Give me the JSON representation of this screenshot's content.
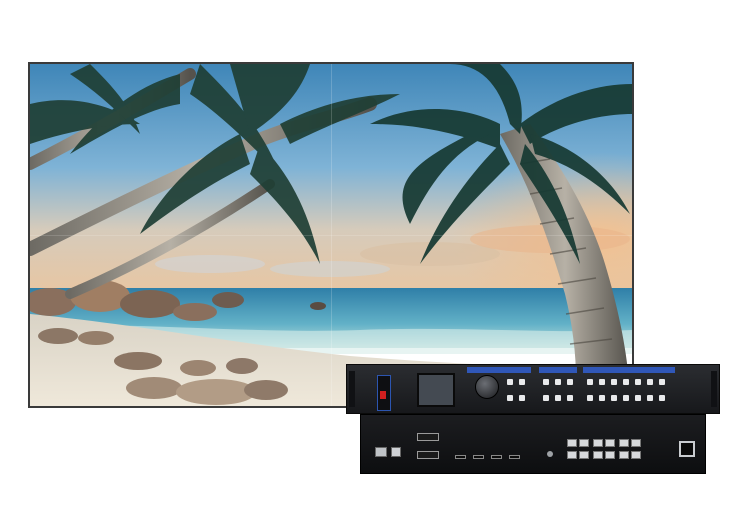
{
  "scene": {
    "subject": "led-video-wall-with-processor",
    "wall_image": "tropical-beach-palm-trees"
  },
  "device": {
    "front_labels": [
      "",
      "",
      ""
    ],
    "colors": {
      "chassis": "#1c1d20",
      "label_blue": "#3057b8",
      "button": "#e9eaec",
      "power_red": "#d01f1f"
    }
  },
  "colors": {
    "sky": "#5c9fc9",
    "sea": "#3f8fb4",
    "sand": "#e9e1d3",
    "frame": "#3a3a3a"
  }
}
